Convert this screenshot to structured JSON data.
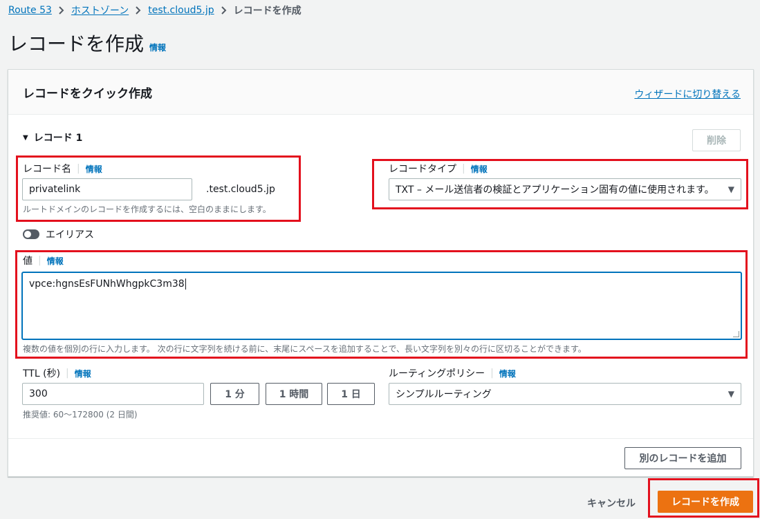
{
  "breadcrumb": {
    "items": [
      "Route 53",
      "ホストゾーン",
      "test.cloud5.jp"
    ],
    "current": "レコードを作成"
  },
  "page": {
    "title": "レコードを作成",
    "info": "情報"
  },
  "panel": {
    "title": "レコードをクイック作成",
    "wizard_link": "ウィザードに切り替える",
    "record_heading": "レコード 1",
    "delete_button": "削除",
    "add_record_button": "別のレコードを追加"
  },
  "record_name": {
    "label": "レコード名",
    "info": "情報",
    "value": "privatelink",
    "suffix": ".test.cloud5.jp",
    "hint": "ルートドメインのレコードを作成するには、空白のままにします。"
  },
  "record_type": {
    "label": "レコードタイプ",
    "info": "情報",
    "selected": "TXT – メール送信者の検証とアプリケーション固有の値に使用されます。"
  },
  "alias": {
    "label": "エイリアス",
    "enabled": false
  },
  "value": {
    "label": "値",
    "info": "情報",
    "text": "vpce:hgnsEsFUNhWhgpkC3m38",
    "hint": "複数の値を個別の行に入力します。 次の行に文字列を続ける前に、末尾にスペースを追加することで、長い文字列を別々の行に区切ることができます。"
  },
  "ttl": {
    "label": "TTL (秒)",
    "info": "情報",
    "value": "300",
    "buttons": [
      "1 分",
      "1 時間",
      "1 日"
    ],
    "hint": "推奨値: 60～172800 (2 日間)"
  },
  "routing_policy": {
    "label": "ルーティングポリシー",
    "info": "情報",
    "selected": "シンプルルーティング"
  },
  "footer": {
    "cancel": "キャンセル",
    "create": "レコードを作成"
  },
  "colors": {
    "link": "#0073bb",
    "primary": "#ec7211",
    "highlight": "#e3101d",
    "background": "#f2f3f3"
  },
  "icons": {
    "breadcrumb_separator": "chevron-right-icon",
    "expand": "caret-down-icon",
    "select": "caret-down-icon",
    "alias_toggle": "toggle-icon"
  }
}
